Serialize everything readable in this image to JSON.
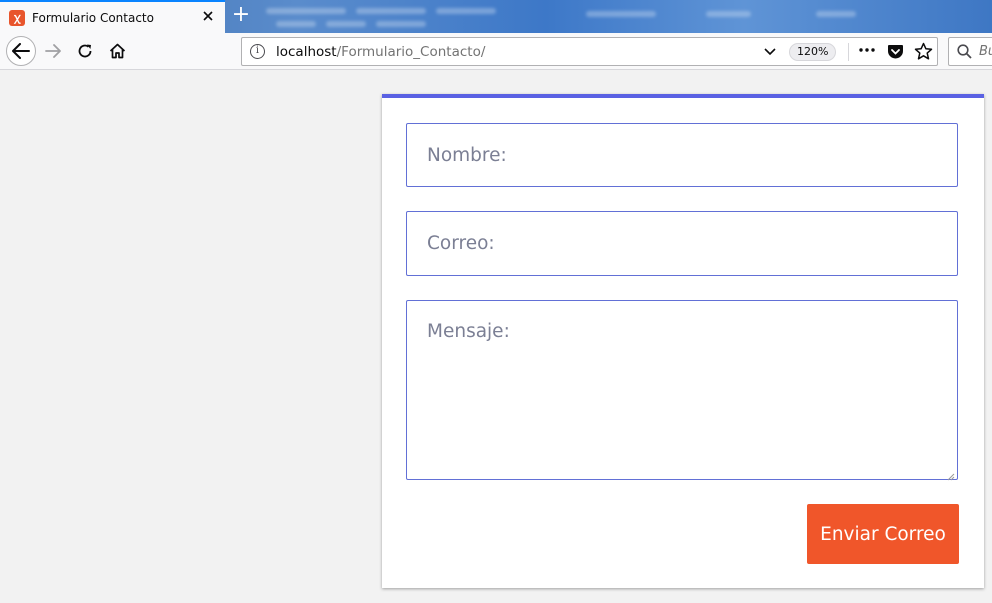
{
  "browser": {
    "tab": {
      "title": "Formulario Contacto"
    },
    "url": {
      "host": "localhost",
      "path": "/Formulario_Contacto/"
    },
    "zoom": "120%",
    "search": {
      "placeholder": "Bu"
    },
    "accent_color": "#0a84ff"
  },
  "icons": {
    "back": "arrow-left-icon",
    "forward": "arrow-right-icon",
    "reload": "reload-icon",
    "home": "home-icon",
    "info": "info-icon",
    "page_actions": "more-dots-icon",
    "pocket": "pocket-icon",
    "bookmark": "star-icon",
    "search": "search-icon",
    "close": "close-icon",
    "new_tab": "plus-icon",
    "favicon": "xampp-icon"
  },
  "form": {
    "nombre_placeholder": "Nombre:",
    "correo_placeholder": "Correo:",
    "mensaje_placeholder": "Mensaje:",
    "submit_label": "Enviar Correo",
    "accent_color": "#5a61e3",
    "button_color": "#f0562a"
  }
}
